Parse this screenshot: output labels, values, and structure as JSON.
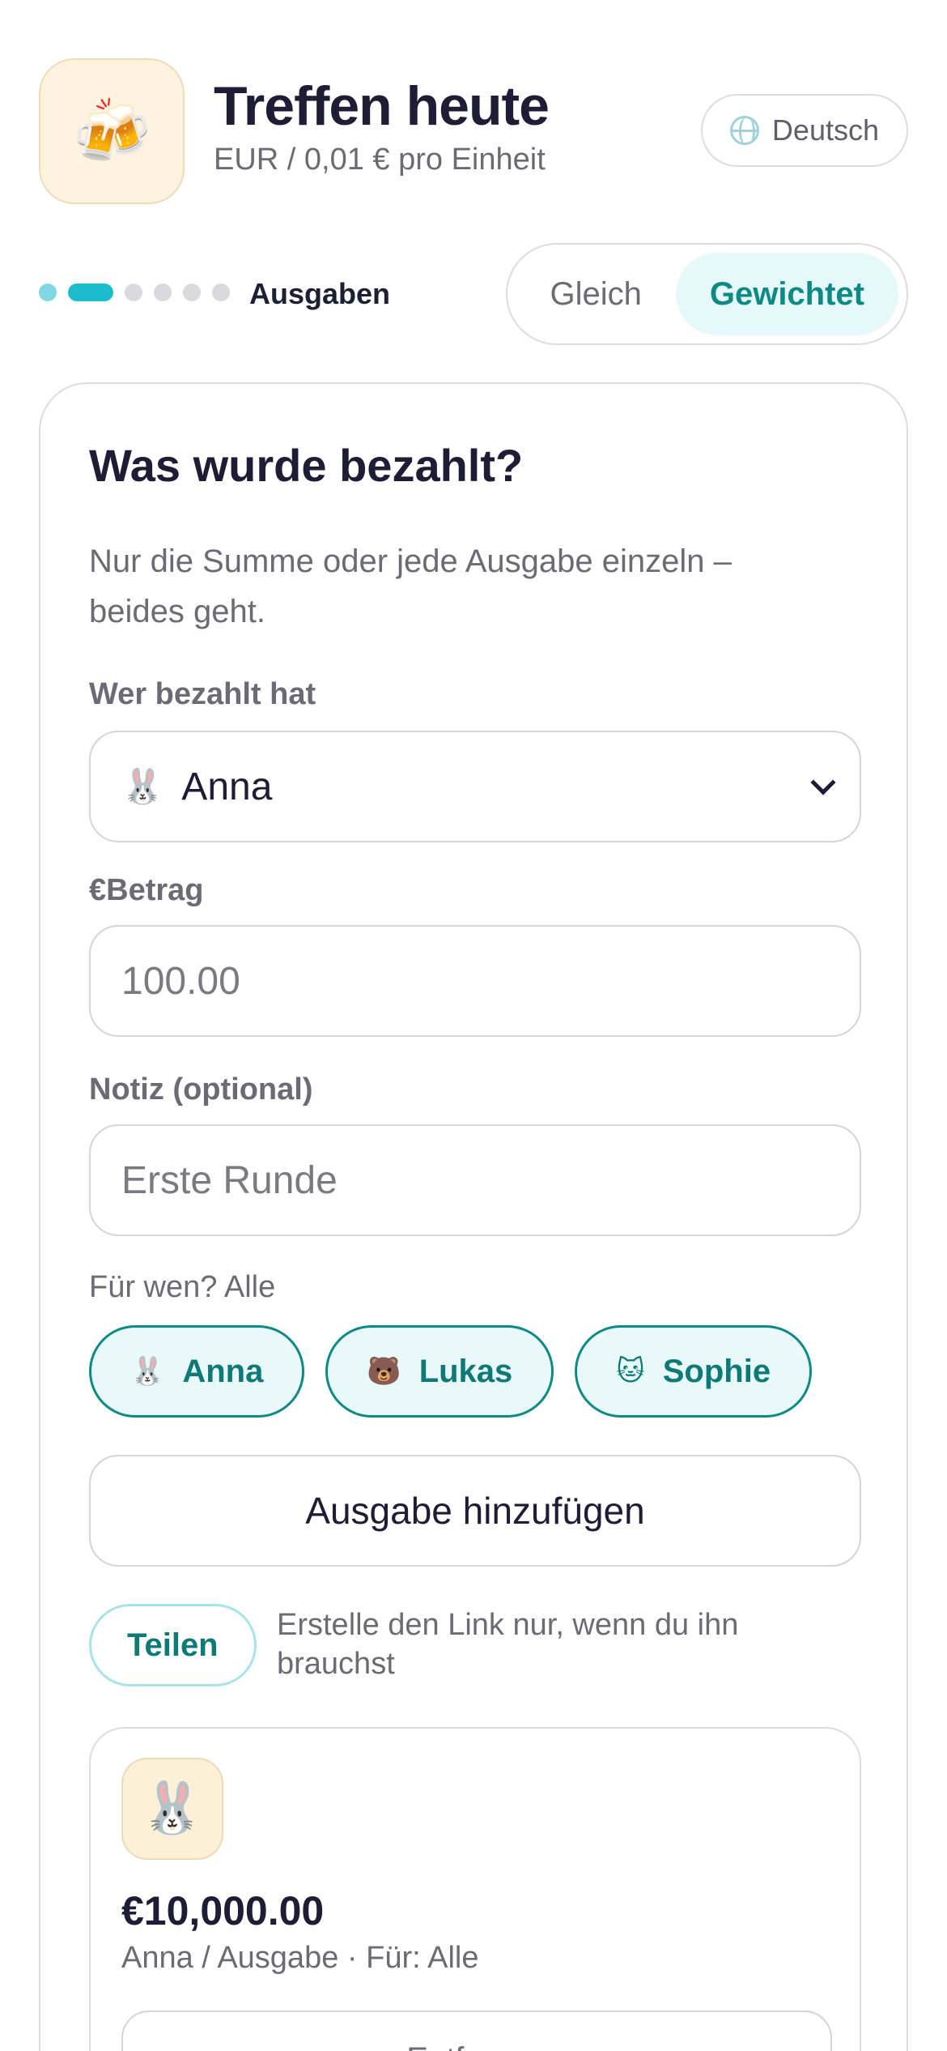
{
  "header": {
    "app_emoji": "🍻",
    "title": "Treffen heute",
    "subtitle": "EUR / 0,01 € pro Einheit",
    "language_label": "Deutsch",
    "language_icon": "globe-icon"
  },
  "steps": {
    "total": 6,
    "current": 2,
    "current_label": "Ausgaben"
  },
  "split_mode": {
    "options": [
      "Gleich",
      "Gewichtet"
    ],
    "selected": "Gewichtet"
  },
  "expense_form": {
    "title": "Was wurde bezahlt?",
    "hint": "Nur die Summe oder jede Ausgabe einzeln – beides geht.",
    "payer_label": "Wer bezahlt hat",
    "payer_emoji": "🐰",
    "payer_value": "Anna",
    "amount_label": "€Betrag",
    "amount_placeholder": "100.00",
    "note_label": "Notiz (optional)",
    "note_placeholder": "Erste Runde",
    "for_whom_label": "Für wen? Alle",
    "participants": [
      {
        "emoji": "🐰",
        "name": "Anna"
      },
      {
        "emoji": "🐻",
        "name": "Lukas"
      },
      {
        "emoji": "🐱",
        "name": "Sophie"
      }
    ],
    "add_button": "Ausgabe hinzufügen"
  },
  "share": {
    "button": "Teilen",
    "hint": "Erstelle den Link nur, wenn du ihn brauchst"
  },
  "expenses": [
    {
      "avatar_emoji": "🐰",
      "amount": "€10,000.00",
      "meta": "Anna / Ausgabe  ·  Für: Alle",
      "remove_label": "Entfernen"
    }
  ],
  "colors": {
    "accent": "#1bbccc",
    "accent_text": "#0d8a86",
    "accent_bg": "#e6f8fa",
    "icon_bg": "#fdf3de"
  }
}
